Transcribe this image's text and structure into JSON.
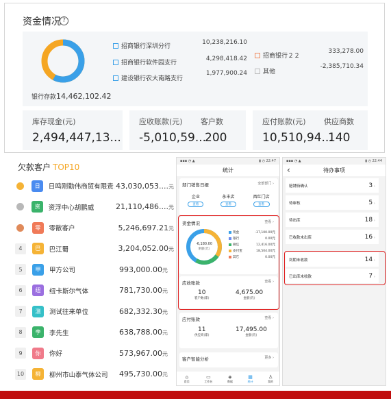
{
  "funds": {
    "title": "资金情况",
    "help": "?",
    "bank_total_label": "银行存款",
    "bank_total_value": "14,462,102.42",
    "accounts_left": [
      {
        "name": "招商银行深圳分行",
        "value": "10,238,216.10"
      },
      {
        "name": "招商银行软件园支行",
        "value": "4,298,418.42"
      },
      {
        "name": "建设银行农大南路支行",
        "value": "1,977,900.24"
      }
    ],
    "accounts_right": [
      {
        "name": "招商银行２２",
        "value": "333,278.00"
      },
      {
        "name": "其他",
        "value": "-2,385,710.34"
      }
    ],
    "cash_label": "库存现金(元)",
    "cash_value": "2,494,447,13...",
    "ar_label": "应收账款(元)",
    "ar_value": "-5,010,59...",
    "ar_count_label": "客户数",
    "ar_count_value": "200",
    "ap_label": "应付账款(元)",
    "ap_value": "10,510,94...",
    "ap_count_label": "供应商数",
    "ap_count_value": "140",
    "colors": {
      "blue": "#3aa0e8",
      "orange": "#f5a623",
      "square_orange": "#f08a5d",
      "square_gray": "#bbbbbb"
    }
  },
  "top10": {
    "title": "欠款客户",
    "title_accent": "TOP10",
    "unit": "元",
    "rows": [
      {
        "rank": "1",
        "avatar": "日",
        "color": "#4a8bf0",
        "name": "日鸣刚勤伟商贸有限责...",
        "value": "43,030,053...."
      },
      {
        "rank": "2",
        "avatar": "资",
        "color": "#3bb36b",
        "name": "资浮中心胡鹏威",
        "value": "21,110,486...."
      },
      {
        "rank": "3",
        "avatar": "零",
        "color": "#f07a58",
        "name": "零散客户",
        "value": "5,246,697.21"
      },
      {
        "rank": "4",
        "avatar": "巴",
        "color": "#f5b336",
        "name": "巴江蜀",
        "value": "3,204,052.00"
      },
      {
        "rank": "5",
        "avatar": "甲",
        "color": "#3aa0e8",
        "name": "甲方公司",
        "value": "993,000.00"
      },
      {
        "rank": "6",
        "avatar": "纽",
        "color": "#9b6fe0",
        "name": "纽卡斯尔气体",
        "value": "781,730.00"
      },
      {
        "rank": "7",
        "avatar": "测",
        "color": "#35c0c8",
        "name": "测试往来单位",
        "value": "682,332.30"
      },
      {
        "rank": "8",
        "avatar": "李",
        "color": "#3bb36b",
        "name": "李先生",
        "value": "638,788.00"
      },
      {
        "rank": "9",
        "avatar": "你",
        "color": "#f07a8a",
        "name": "你好",
        "value": "573,967.00"
      },
      {
        "rank": "10",
        "avatar": "柳",
        "color": "#f5b336",
        "name": "柳州市山泰气体公司",
        "value": "495,730.00"
      }
    ]
  },
  "phone1": {
    "title": "统计",
    "sales_title": "部门销售日报",
    "sales_more": "全部部门 ›",
    "stores": [
      "企业",
      "永丰店",
      "西红门店"
    ],
    "store_btn": "查看",
    "funds_title": "资金情况",
    "funds_more": "查看 ›",
    "donut_center_value": "-6,180.00",
    "donut_center_label": "余额(元)",
    "legend": [
      {
        "name": "现金",
        "value": "-37,100.00元",
        "color": "#3aa0e8"
      },
      {
        "name": "银行",
        "value": "0.00元",
        "color": "#6c8cf0"
      },
      {
        "name": "微信",
        "value": "12,416.00元",
        "color": "#3bb36b"
      },
      {
        "name": "支付宝",
        "value": "18,504.00元",
        "color": "#f5b336"
      },
      {
        "name": "其它",
        "value": "0.00元",
        "color": "#f07a58"
      }
    ],
    "ar_title": "应收账款",
    "ar_more": "查看 ›",
    "ar_count": "10",
    "ar_count_label": "客户数(家)",
    "ar_amount": "4,675.00",
    "ar_amount_label": "金额(元)",
    "ap_title": "应付账款",
    "ap_more": "查看 ›",
    "ap_count": "11",
    "ap_count_label": "供应商(家)",
    "ap_amount": "17,495.00",
    "ap_amount_label": "金额(元)",
    "analysis_title": "客户智能分析",
    "analysis_more": "更多 ›",
    "tabs": [
      "首页",
      "工作台",
      "数据",
      "统计",
      "我的"
    ]
  },
  "phone2": {
    "title": "待办事项",
    "back": "‹",
    "rows": [
      {
        "label": "赔铺待确认",
        "count": "3"
      },
      {
        "label": "待审核",
        "count": "5"
      },
      {
        "label": "待出库",
        "count": "18"
      },
      {
        "label": "已收款未出库",
        "count": "16"
      },
      {
        "label": "到期未收款",
        "count": "14"
      },
      {
        "label": "已出库未收款",
        "count": "7"
      }
    ]
  }
}
